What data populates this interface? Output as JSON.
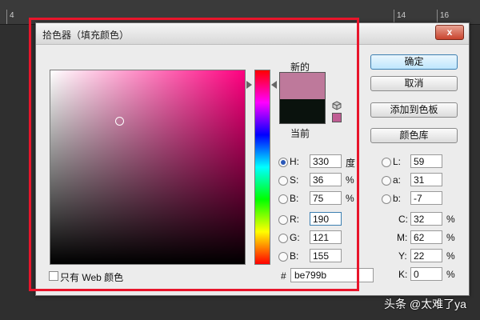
{
  "ruler": {
    "marks": [
      "4",
      "14",
      "16"
    ]
  },
  "dialog": {
    "title": "拾色器（填充颜色）",
    "close_label": "x",
    "preview": {
      "new_label": "新的",
      "current_label": "当前",
      "new_color": "#be799b",
      "current_color": "#0a120d"
    },
    "hue_value": 330,
    "buttons": {
      "ok": "确定",
      "cancel": "取消",
      "add_to_swatches": "添加到色板",
      "color_libraries": "颜色库"
    },
    "hsb": [
      {
        "label": "H:",
        "value": "330",
        "unit": "度",
        "selected": true
      },
      {
        "label": "S:",
        "value": "36",
        "unit": "%",
        "selected": false
      },
      {
        "label": "B:",
        "value": "75",
        "unit": "%",
        "selected": false
      }
    ],
    "rgb": [
      {
        "label": "R:",
        "value": "190"
      },
      {
        "label": "G:",
        "value": "121"
      },
      {
        "label": "B:",
        "value": "155"
      }
    ],
    "lab": [
      {
        "label": "L:",
        "value": "59"
      },
      {
        "label": "a:",
        "value": "31"
      },
      {
        "label": "b:",
        "value": "-7"
      }
    ],
    "cmyk": [
      {
        "label": "C:",
        "value": "32",
        "unit": "%"
      },
      {
        "label": "M:",
        "value": "62",
        "unit": "%"
      },
      {
        "label": "Y:",
        "value": "22",
        "unit": "%"
      },
      {
        "label": "K:",
        "value": "0",
        "unit": "%"
      }
    ],
    "web_only_label": "只有 Web 颜色",
    "hex_hash": "#",
    "hex_value": "be799b"
  },
  "watermark": "头条 @太难了ya",
  "colors": {
    "highlight": "#e8152b",
    "accent": "#2a58b8"
  }
}
